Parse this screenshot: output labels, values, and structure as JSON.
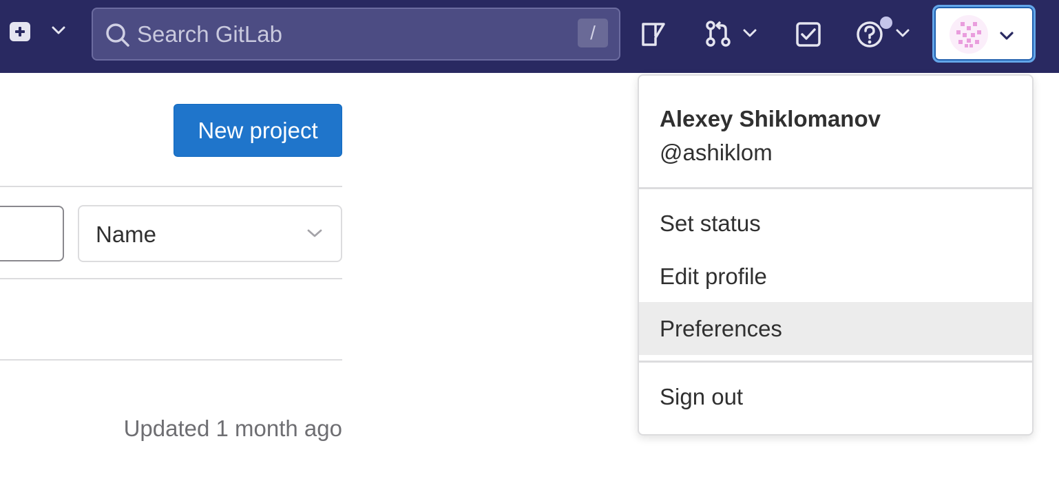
{
  "navbar": {
    "plus_icon": "plus-square-icon",
    "search": {
      "placeholder": "Search GitLab",
      "shortcut": "/"
    },
    "icons": [
      "issues-icon",
      "merge-request-icon",
      "todo-checkbox-icon",
      "help-icon"
    ],
    "colors": {
      "background": "#292961",
      "search_bg": "#4c4c83",
      "avatar_focus": "#63a6e9"
    }
  },
  "main": {
    "new_project_label": "New project",
    "sort_selected": "Name",
    "updated_text": "Updated 1 month ago",
    "colors": {
      "primary_button": "#1f75cb"
    }
  },
  "user_menu": {
    "name": "Alexey Shiklomanov",
    "username": "@ashiklom",
    "items": [
      {
        "label": "Set status"
      },
      {
        "label": "Edit profile"
      },
      {
        "label": "Preferences",
        "highlighted": true
      },
      {
        "label": "Sign out"
      }
    ]
  }
}
